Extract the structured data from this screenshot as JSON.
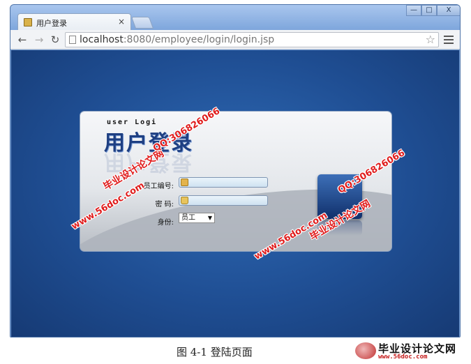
{
  "browser": {
    "tab_title": "用户登录",
    "tab_close": "×",
    "url_host": "localhost",
    "url_rest": ":8080/employee/login/login.jsp",
    "window_controls": {
      "minimize": "—",
      "maximize": "□",
      "close": "X"
    }
  },
  "login": {
    "subtitle": "user Logi",
    "title": "用户登录",
    "employee_id_label": "员工编号:",
    "password_label": "密 码:",
    "role_label": "身份:",
    "role_selected": "员工",
    "role_caret": "▼"
  },
  "watermarks": {
    "site_url": "www.56doc.com",
    "site_name": "毕业设计论文网",
    "qq": "QQ:306826066"
  },
  "caption": "图 4-1  登陆页面",
  "brand": {
    "name": "毕业设计论文网",
    "url": "www.56doc.com"
  },
  "colors": {
    "watermark": "#e01c1c",
    "page_background": "#1f4e93"
  }
}
